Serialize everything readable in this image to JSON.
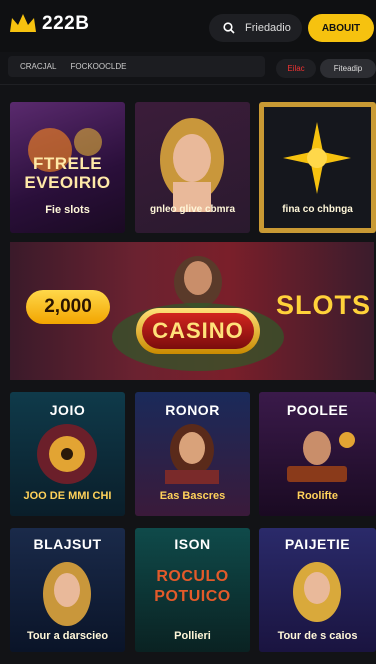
{
  "header": {
    "logo_text": "222B",
    "search_placeholder": "Friedadio",
    "about_label": "ABOUIT"
  },
  "subbar": {
    "item1": "CRACJAL",
    "item2": "FOCKOOCLDE"
  },
  "chips": {
    "chip1": "Eilac",
    "chip2": "Fiteadip"
  },
  "row1": [
    {
      "title": "FTRELE EVEOIRIO",
      "label": "Fie slots"
    },
    {
      "title": "",
      "label": "gnleo glive cbmra"
    },
    {
      "title": "",
      "label": "fina co chbnga"
    }
  ],
  "hero": {
    "amount": "2,000",
    "badge": "CASINO",
    "slots": "SLOTS"
  },
  "row2": [
    {
      "title": "JOIO",
      "label": "JOO DE MMI CHI"
    },
    {
      "title": "RONOR",
      "label": "Eas Bascres"
    },
    {
      "title": "POOLEE",
      "label": "Roolifte"
    }
  ],
  "row3": [
    {
      "title": "BLAJSUT",
      "label": "Tour a darscieo"
    },
    {
      "title": "ISON",
      "label": "Pollieri",
      "art1": "ROCULO",
      "art2": "POTUICO"
    },
    {
      "title": "PAIJETIE",
      "label": "Tour de s caios"
    }
  ],
  "colors": {
    "accent": "#f6c20f",
    "background": "#121316",
    "chip_red": "#ee3333"
  }
}
